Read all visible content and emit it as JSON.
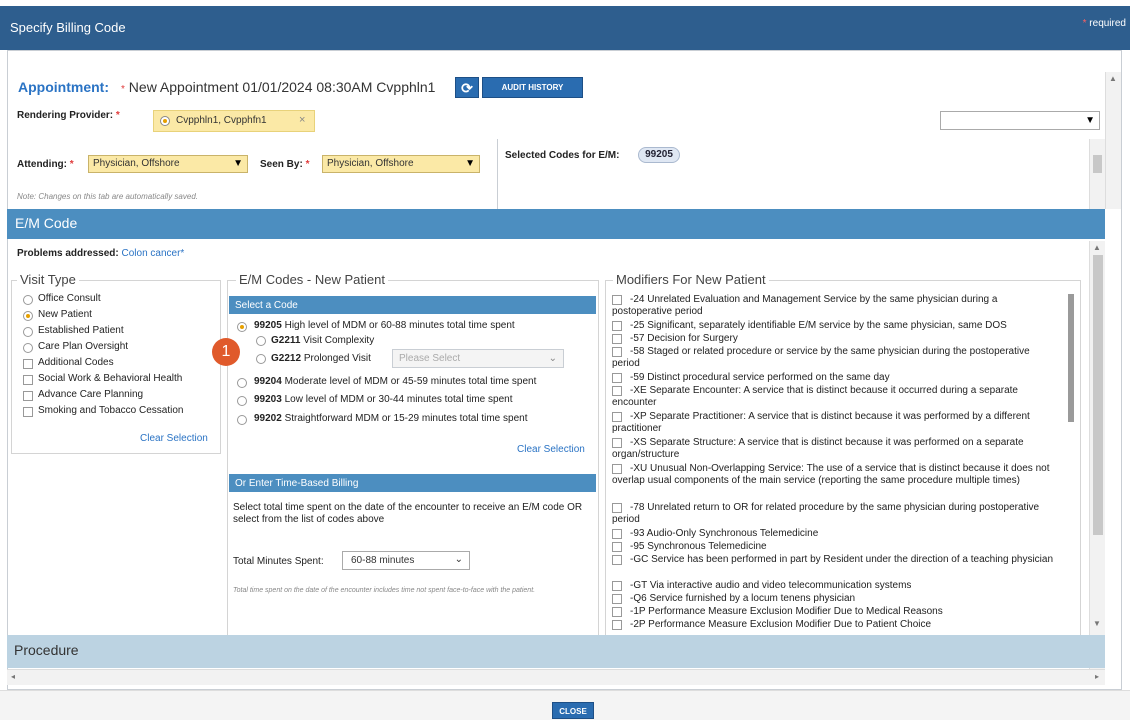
{
  "window": {
    "title": "Specify Billing Code",
    "required_mark": "*",
    "required_label": "required"
  },
  "appointment": {
    "label": "Appointment:",
    "req": "*",
    "value": "New Appointment 01/01/2024 08:30AM Cvpphln1",
    "refresh_glyph": "⟳",
    "audit_label": "AUDIT HISTORY"
  },
  "rendering_provider": {
    "label": "Rendering Provider:",
    "req": "*",
    "value": "Cvpphln1, Cvpphfn1",
    "remove_glyph": "×"
  },
  "attending": {
    "label": "Attending:",
    "req": "*",
    "value": "Physician, Offshore"
  },
  "seen_by": {
    "label": "Seen By:",
    "req": "*",
    "value": "Physician, Offshore"
  },
  "note": "Note: Changes on this tab are automatically saved.",
  "selected_codes": {
    "label": "Selected Codes for E/M:",
    "code": "99205"
  },
  "em_section": {
    "title": "E/M Code"
  },
  "problems": {
    "label": "Problems addressed:",
    "value": "Colon cancer",
    "req": "*"
  },
  "visit_type": {
    "legend": "Visit Type",
    "options": [
      {
        "label": "Office Consult",
        "kind": "radio",
        "selected": false
      },
      {
        "label": "New Patient",
        "kind": "radio",
        "selected": true
      },
      {
        "label": "Established Patient",
        "kind": "radio",
        "selected": false
      },
      {
        "label": "Care Plan Oversight",
        "kind": "radio",
        "selected": false
      },
      {
        "label": "Additional Codes",
        "kind": "checkbox",
        "selected": false
      },
      {
        "label": "Social Work & Behavioral Health",
        "kind": "checkbox",
        "selected": false
      },
      {
        "label": "Advance Care Planning",
        "kind": "checkbox",
        "selected": false
      },
      {
        "label": "Smoking and Tobacco Cessation",
        "kind": "checkbox",
        "selected": false
      }
    ],
    "clear_label": "Clear Selection"
  },
  "em_codes": {
    "legend": "E/M Codes - New Patient",
    "select_header": "Select a Code",
    "codes": [
      {
        "code": "99205",
        "desc": "High level of MDM or 60-88 minutes total time spent",
        "selected": true
      },
      {
        "code": "99204",
        "desc": "Moderate level of MDM or 45-59 minutes total time spent",
        "selected": false
      },
      {
        "code": "99203",
        "desc": "Low level of MDM or 30-44 minutes total time spent",
        "selected": false
      },
      {
        "code": "99202",
        "desc": "Straightforward MDM or 15-29 minutes total time spent",
        "selected": false
      }
    ],
    "subcodes": [
      {
        "code": "G2211",
        "desc": "Visit Complexity"
      },
      {
        "code": "G2212",
        "desc": "Prolonged Visit"
      }
    ],
    "prolonged_placeholder": "Please Select",
    "clear_label": "Clear Selection",
    "time_header": "Or Enter Time-Based Billing",
    "time_instructions": "Select total time spent on the date of the encounter to receive an E/M code OR select from the list of codes above",
    "total_minutes_label": "Total Minutes Spent:",
    "total_minutes_value": "60-88 minutes",
    "time_note": "Total time spent on the date of the encounter includes time not spent face-to-face with the patient."
  },
  "modifiers": {
    "legend": "Modifiers For New Patient",
    "items": [
      "-24 Unrelated Evaluation and Management Service by the same physician during a postoperative period",
      "-25 Significant, separately identifiable E/M service by the same physician, same DOS",
      "-57 Decision for Surgery",
      "-58 Staged or related procedure or service by the same physician during the postoperative period",
      "-59 Distinct procedural service performed on the same day",
      "-XE Separate Encounter: A service that is distinct because it occurred during a separate encounter",
      "-XP Separate Practitioner: A service that is distinct because it was performed by a different practitioner",
      "-XS Separate Structure: A service that is distinct because it was performed on a separate organ/structure",
      "-XU Unusual Non-Overlapping Service: The use of a service that is distinct because it does not overlap usual components of the main service (reporting the same procedure multiple times)",
      "-78 Unrelated return to OR for related procedure by the same physician during postoperative period",
      "-93 Audio-Only Synchronous Telemedicine",
      "-95 Synchronous Telemedicine",
      "-GC Service has been performed in part by Resident under the direction of a teaching physician",
      "-GT Via interactive audio and video telecommunication systems",
      "-Q6 Service furnished by a locum tenens physician",
      "-1P Performance Measure Exclusion Modifier Due to Medical Reasons",
      "-2P Performance Measure Exclusion Modifier Due to Patient Choice"
    ]
  },
  "badge": "1",
  "procedure": {
    "title": "Procedure"
  },
  "footer": {
    "close_label": "CLOSE"
  },
  "colors": {
    "titlebar": "#2e5e8e",
    "section_header": "#4c8ec0",
    "highlight": "#fbe9a6",
    "link": "#2a73c4",
    "badge": "#e05a2b"
  }
}
